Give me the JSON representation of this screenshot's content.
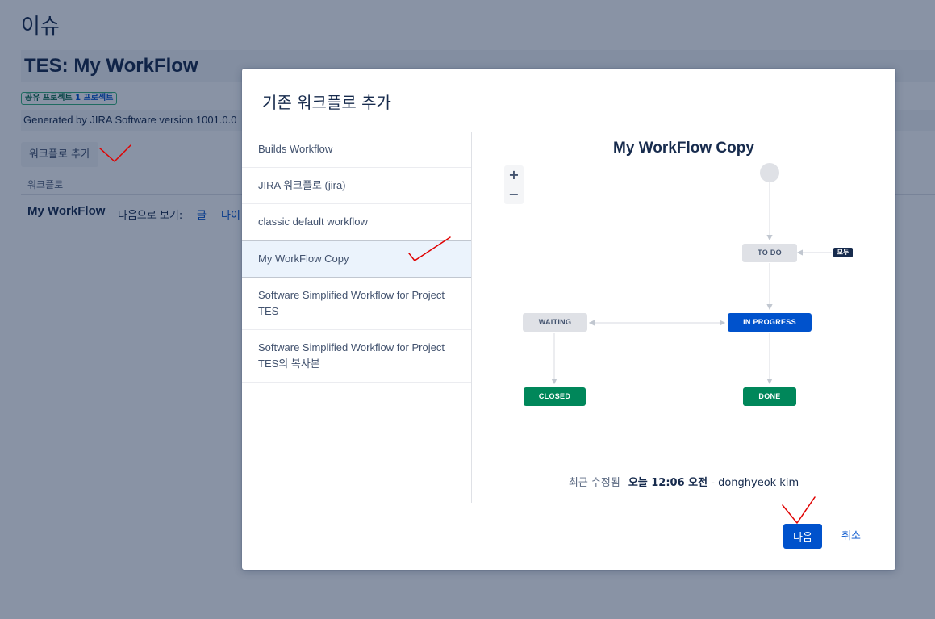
{
  "background": {
    "page_heading": "이슈",
    "workflow_title": "TES: My WorkFlow",
    "shared_badge_prefix": "공유 프로젝트",
    "shared_badge_link": "1 프로젝트",
    "generated_text": "Generated by JIRA Software version 1001.0.0",
    "add_workflow_button": "워크플로 추가",
    "table_header": "워크플로",
    "row_name": "My WorkFlow",
    "view_as_label": "다음으로 보기:",
    "view_text_link": "글",
    "view_diagram_link": "다이"
  },
  "modal": {
    "title": "기존 워크플로 추가",
    "workflows": [
      {
        "label": "Builds Workflow",
        "selected": false
      },
      {
        "label": "JIRA 워크플로 (jira)",
        "selected": false
      },
      {
        "label": "classic default workflow",
        "selected": false
      },
      {
        "label": "My WorkFlow Copy",
        "selected": true
      },
      {
        "label": "Software Simplified Workflow for Project TES",
        "selected": false
      },
      {
        "label": "Software Simplified Workflow for Project TES의 복사본",
        "selected": false
      }
    ],
    "preview": {
      "title": "My WorkFlow Copy",
      "zoom_in": "+",
      "zoom_out": "−",
      "statuses": {
        "todo": "TO DO",
        "in_progress": "IN PROGRESS",
        "waiting": "WAITING",
        "closed": "CLOSED",
        "done": "DONE"
      },
      "all_tag": "모두",
      "last_modified_label": "최근 수정됨",
      "last_modified_when": "오늘 12:06 오전",
      "last_modified_sep": " - ",
      "last_modified_by": "donghyeok kim"
    },
    "next_button": "다음",
    "cancel_link": "취소"
  },
  "colors": {
    "primary": "#0052cc",
    "success": "#00875a",
    "neutral": "#dfe1e6",
    "annotation_red": "#e00000"
  }
}
